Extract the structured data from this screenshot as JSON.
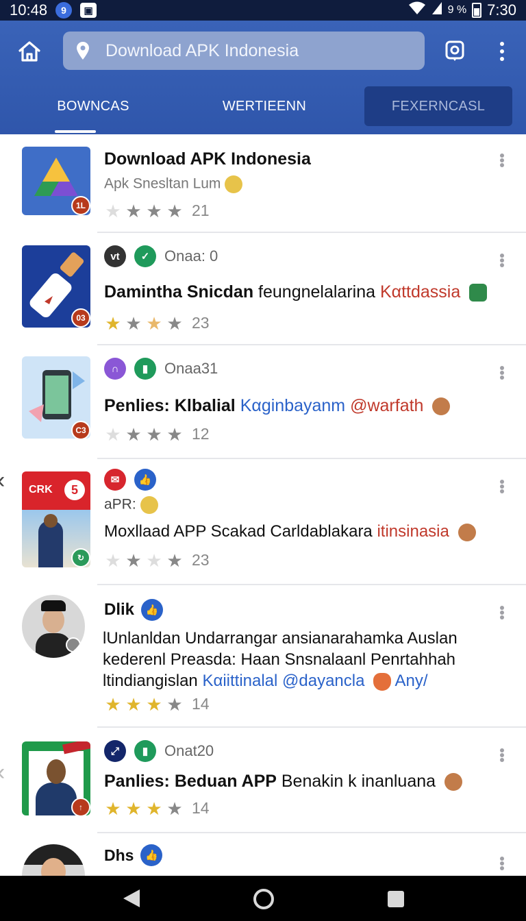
{
  "status_bar": {
    "time_left": "10:48",
    "time_right": "7:30",
    "signal_text": "9 %",
    "badge_1": "9"
  },
  "toolbar": {
    "search_text": "Download APK Indonesia"
  },
  "tabs": [
    {
      "label": "BOWNCAS",
      "active": true
    },
    {
      "label": "WERTIEENN",
      "active": false
    },
    {
      "label": "FEXERNCASL",
      "active": false
    }
  ],
  "items": [
    {
      "title": "Download APK Indonesia",
      "subtitle": "Apk Snesltan Lum",
      "badge": "1L",
      "rating_count": "21"
    },
    {
      "meta": "Onaa: 0",
      "title_bold": "Damintha Snicdan",
      "title_rest": "feungnelalarina",
      "title_link": "Kαttdassia",
      "badge": "03",
      "rating_count": "23"
    },
    {
      "meta": "Onaa31",
      "title_bold": "Penlies: Klbalial",
      "title_link_1": "Kαginbayanm",
      "title_link_2": "@warfath",
      "badge": "C3",
      "rating_count": "12"
    },
    {
      "sub": "aPR:",
      "thumb_label": "CRK",
      "thumb_number": "5",
      "title_plain": "Moxllaad APP Scakad Carldablakara",
      "title_link": "itinsinasia",
      "rating_count": "23"
    },
    {
      "title": "Dlik",
      "line_1": "lUnlanldan Undarrangar ansianarahamka Auslan",
      "line_2": "kederenl Preasda: Haan Snsnalaanl Penrtahhah",
      "line_3_plain": "ltindiangislan",
      "line_3_link": "Kαiittinalal @dayancla",
      "line_3_end": "Any/",
      "rating_count": "14"
    },
    {
      "meta": "Onat20",
      "title_bold": "Panlies: Beduan APP",
      "title_rest": "Benakin k inanluana",
      "rating_count": "14"
    },
    {
      "title": "Dhs"
    }
  ],
  "colors": {
    "app_bar": "#3a63b8",
    "tab_active_bg": "#1e3d86",
    "star_gold": "#e0b52c"
  }
}
